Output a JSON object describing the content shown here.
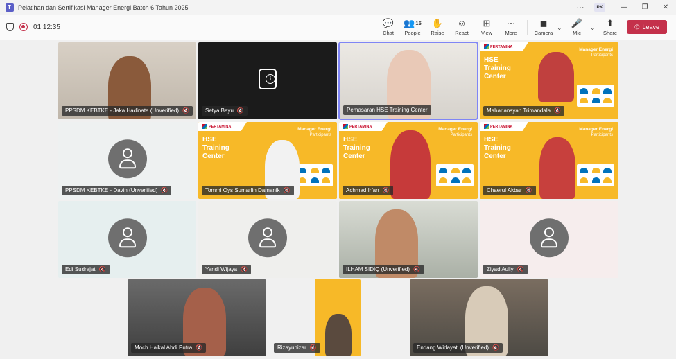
{
  "window": {
    "title": "Pelatihan dan Sertifikasi Manager Energi Batch 6 Tahun 2025",
    "more_label": "···",
    "user_initials": "PK",
    "minimize": "—",
    "maximize": "❐",
    "close": "✕"
  },
  "meeting": {
    "elapsed": "01:12:35"
  },
  "toolbar": {
    "chat": "Chat",
    "people": "People",
    "people_count": "15",
    "raise": "Raise",
    "react": "React",
    "view": "View",
    "more": "More",
    "camera": "Camera",
    "mic": "Mic",
    "share": "Share",
    "leave": "Leave"
  },
  "icons": {
    "chat": "chat-icon",
    "people": "people-icon",
    "raise": "hand-icon",
    "react": "smile-icon",
    "view": "grid-icon",
    "more": "ellipsis-icon",
    "camera": "video-icon",
    "mic": "mic-off-icon",
    "share": "share-icon",
    "leave": "phone-icon"
  },
  "colors": {
    "leave_red": "#c4314b",
    "brand_yellow": "#f7b928",
    "active_outline": "#7f85f5"
  },
  "branding": {
    "logo_text": "PERTAMINA",
    "corner_title": "Manager Energi",
    "corner_sub": "Participants",
    "title_line1": "HSE",
    "title_line2": "Training",
    "title_line3": "Center"
  },
  "participants": [
    {
      "name": "PPSDM KEBTKE - Jaka Hadinata (Unverified)",
      "muted": true
    },
    {
      "name": "Setya Bayu",
      "muted": true
    },
    {
      "name": "Pemasaran HSE Training Center",
      "muted": false
    },
    {
      "name": "Mahariansyah Trimandala",
      "muted": true
    },
    {
      "name": "PPSDM KEBTKE - Davin (Unverified)",
      "muted": true
    },
    {
      "name": "Tommi Oys Sumarlin Damanik",
      "muted": true
    },
    {
      "name": "Achmad Irfan",
      "muted": true
    },
    {
      "name": "Chaerul Akbar",
      "muted": true
    },
    {
      "name": "Edi Sudrajat",
      "muted": true
    },
    {
      "name": "Yandi Wijaya",
      "muted": true
    },
    {
      "name": "ILHAM SIDIQ (Unverified)",
      "muted": true
    },
    {
      "name": "Ziyad Auliy",
      "muted": true
    },
    {
      "name": "Moch Haikal Abdi Putra",
      "muted": true
    },
    {
      "name": "Rizayunizar",
      "muted": true
    },
    {
      "name": "Endang Widayati (Unverified)",
      "muted": true
    }
  ]
}
